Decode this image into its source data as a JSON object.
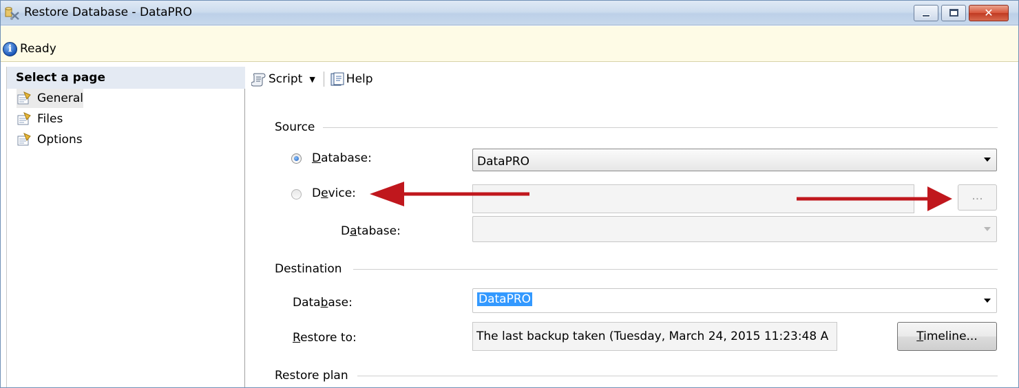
{
  "window": {
    "title": "Restore Database - DataPRO",
    "buttons": {
      "minimize": "minimize",
      "maximize": "maximize",
      "close": "✕"
    }
  },
  "status": {
    "text": "Ready",
    "icon": "info-icon"
  },
  "nav": {
    "header": "Select a page",
    "items": [
      {
        "label": "General",
        "icon": "page-icon",
        "active": true
      },
      {
        "label": "Files",
        "icon": "page-icon",
        "active": false
      },
      {
        "label": "Options",
        "icon": "page-icon",
        "active": false
      }
    ]
  },
  "toolbar": {
    "script_label": "Script",
    "help_label": "Help"
  },
  "source": {
    "heading": "Source",
    "database_radio": {
      "label_pre": "",
      "label_u": "D",
      "label_post": "atabase:",
      "checked": true
    },
    "database_value": "DataPRO",
    "device_radio": {
      "label_pre": "D",
      "label_u": "e",
      "label_post": "vice:",
      "checked": false
    },
    "device_value": "",
    "device_browse": "...",
    "device_database": {
      "label_pre": "D",
      "label_u": "a",
      "label_post": "tabase:",
      "value": ""
    }
  },
  "destination": {
    "heading": "Destination",
    "database": {
      "label_pre": "Data",
      "label_u": "b",
      "label_post": "ase:",
      "value": "DataPRO"
    },
    "restore_to": {
      "label_pre": "",
      "label_u": "R",
      "label_post": "estore to:",
      "value": "The last backup taken (Tuesday, March 24, 2015 11:23:48 A"
    },
    "timeline": {
      "label_u": "T",
      "label_post": "imeline..."
    }
  },
  "restore_plan": {
    "heading": "Restore plan"
  },
  "colors": {
    "annotation_arrow": "#c0171d",
    "selection": "#3399ff"
  }
}
